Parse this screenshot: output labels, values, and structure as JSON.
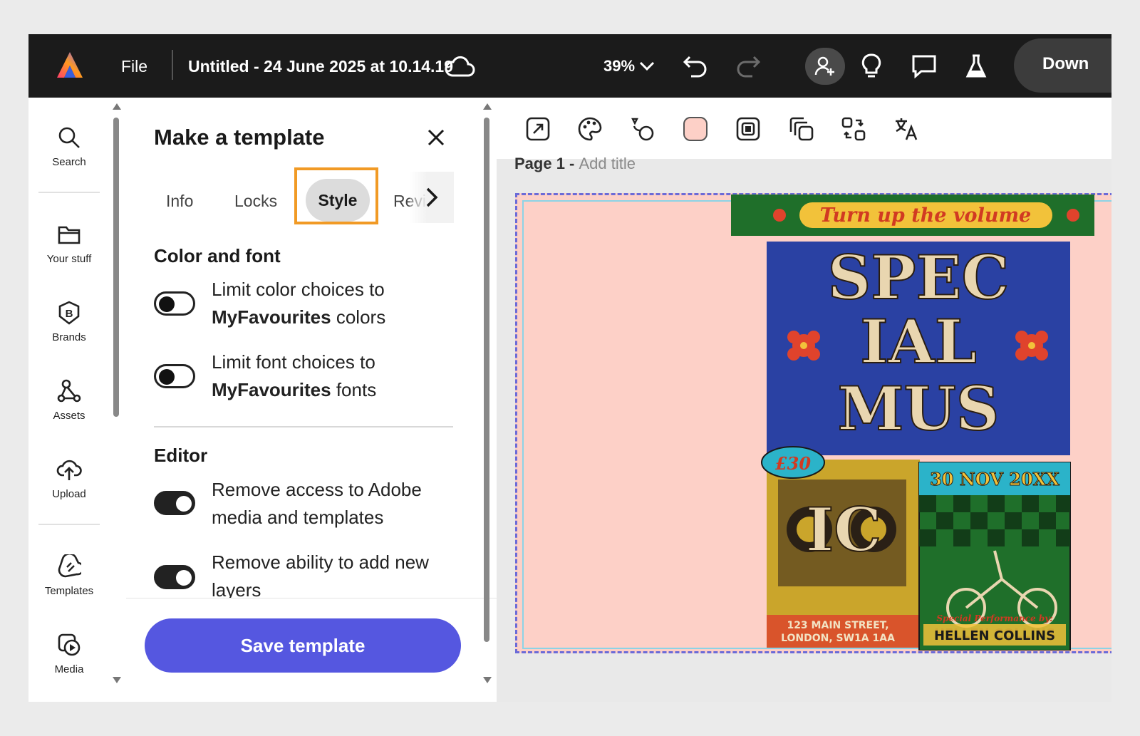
{
  "topbar": {
    "file_label": "File",
    "doc_title": "Untitled - 24 June 2025 at 10.14.19",
    "zoom": "39%",
    "download_label": "Down"
  },
  "rail": {
    "items": [
      {
        "label": "Search"
      },
      {
        "label": "Your stuff"
      },
      {
        "label": "Brands"
      },
      {
        "label": "Assets"
      },
      {
        "label": "Upload"
      },
      {
        "label": "Templates"
      },
      {
        "label": "Media"
      }
    ]
  },
  "panel": {
    "title": "Make a template",
    "tabs": [
      {
        "label": "Info"
      },
      {
        "label": "Locks"
      },
      {
        "label": "Style",
        "active": true
      },
      {
        "label": "Revie"
      }
    ],
    "sections": {
      "color_font": {
        "title": "Color and font",
        "toggle1": {
          "line1": "Limit color choices to",
          "bold": "MyFavourites",
          "rest": " colors",
          "on": false
        },
        "toggle2": {
          "line1": "Limit font choices to",
          "bold": "MyFavourites",
          "rest": " fonts",
          "on": false
        }
      },
      "editor": {
        "title": "Editor",
        "toggle1": {
          "line1": "Remove access to Adobe",
          "line2": "media and templates",
          "on": true
        },
        "toggle2": {
          "line1": "Remove ability to add new",
          "line2": "layers",
          "on": true
        }
      }
    },
    "save_label": "Save template"
  },
  "canvas": {
    "page_label": "Page 1 - ",
    "add_title": "Add title",
    "page_color": "#fdd0c7"
  },
  "poster": {
    "banner": "Turn up the volume",
    "headline1": "SPEC",
    "headline2": "IAL",
    "headline3": "MUS",
    "headline4": "IC",
    "price": "£30",
    "date": "30 NOV 20XX",
    "address1": "123 MAIN STREET,",
    "address2": "LONDON, SW1A 1AA",
    "performer_intro": "Special Performance by:",
    "performer": "HELLEN COLLINS"
  },
  "colors": {
    "accent": "#5557e0",
    "highlight": "#f19a25",
    "topbar": "#1b1b1b"
  }
}
